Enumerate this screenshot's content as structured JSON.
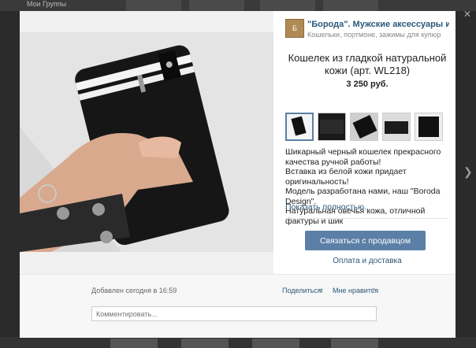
{
  "background": {
    "top_link": "Мои Группы"
  },
  "shop": {
    "name": "\"Борода\". Мужские аксессуары и украш...",
    "subtitle": "Кошельки, портмоне, зажимы для купюр",
    "logo_text": "Б"
  },
  "product": {
    "title": "Кошелек из гладкой натуральной кожи (арт. WL218)",
    "price": "3 250 руб.",
    "description": "Шикарный черный кошелек прекрасного качества ручной работы!\nВставка из белой кожи придает оригинальность!\nМодель разработана нами, наш \"Boroda Design\".\nНатуральная овечья кожа, отличной фактуры и шик",
    "show_more": "Показать полностью..",
    "contact_button": "Связаться с продавцом",
    "payment_link": "Оплата и доставка"
  },
  "footer": {
    "added": "Добавлен сегодня в 16:59",
    "share": "Поделиться",
    "like": "Мне нравится",
    "comment_placeholder": "Комментировать..."
  },
  "icons": {
    "close": "close-icon",
    "next": "chevron-right-icon",
    "share": "megaphone-icon",
    "like": "heart-icon"
  },
  "colors": {
    "accent": "#5b7fa6",
    "link": "#2b587a"
  }
}
